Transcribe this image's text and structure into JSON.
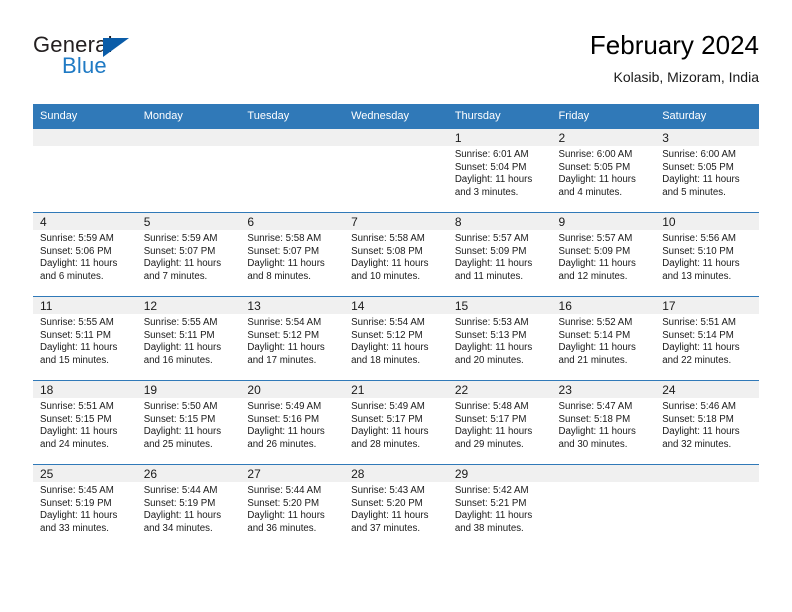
{
  "brand": {
    "name_part1": "General",
    "name_part2": "Blue",
    "logo_icon": "triangle-logo-icon",
    "accent_color": "#1f7ac4"
  },
  "header": {
    "title": "February 2024",
    "subtitle": "Kolasib, Mizoram, India"
  },
  "theme": {
    "header_bg": "#3079b8",
    "daynum_bg": "#f0f0f0",
    "text": "#1a1a1a"
  },
  "calendar": {
    "weekday_headers": [
      "Sunday",
      "Monday",
      "Tuesday",
      "Wednesday",
      "Thursday",
      "Friday",
      "Saturday"
    ],
    "weeks": [
      [
        {
          "day": "",
          "lines": []
        },
        {
          "day": "",
          "lines": []
        },
        {
          "day": "",
          "lines": []
        },
        {
          "day": "",
          "lines": []
        },
        {
          "day": "1",
          "lines": [
            "Sunrise: 6:01 AM",
            "Sunset: 5:04 PM",
            "Daylight: 11 hours",
            "and 3 minutes."
          ]
        },
        {
          "day": "2",
          "lines": [
            "Sunrise: 6:00 AM",
            "Sunset: 5:05 PM",
            "Daylight: 11 hours",
            "and 4 minutes."
          ]
        },
        {
          "day": "3",
          "lines": [
            "Sunrise: 6:00 AM",
            "Sunset: 5:05 PM",
            "Daylight: 11 hours",
            "and 5 minutes."
          ]
        }
      ],
      [
        {
          "day": "4",
          "lines": [
            "Sunrise: 5:59 AM",
            "Sunset: 5:06 PM",
            "Daylight: 11 hours",
            "and 6 minutes."
          ]
        },
        {
          "day": "5",
          "lines": [
            "Sunrise: 5:59 AM",
            "Sunset: 5:07 PM",
            "Daylight: 11 hours",
            "and 7 minutes."
          ]
        },
        {
          "day": "6",
          "lines": [
            "Sunrise: 5:58 AM",
            "Sunset: 5:07 PM",
            "Daylight: 11 hours",
            "and 8 minutes."
          ]
        },
        {
          "day": "7",
          "lines": [
            "Sunrise: 5:58 AM",
            "Sunset: 5:08 PM",
            "Daylight: 11 hours",
            "and 10 minutes."
          ]
        },
        {
          "day": "8",
          "lines": [
            "Sunrise: 5:57 AM",
            "Sunset: 5:09 PM",
            "Daylight: 11 hours",
            "and 11 minutes."
          ]
        },
        {
          "day": "9",
          "lines": [
            "Sunrise: 5:57 AM",
            "Sunset: 5:09 PM",
            "Daylight: 11 hours",
            "and 12 minutes."
          ]
        },
        {
          "day": "10",
          "lines": [
            "Sunrise: 5:56 AM",
            "Sunset: 5:10 PM",
            "Daylight: 11 hours",
            "and 13 minutes."
          ]
        }
      ],
      [
        {
          "day": "11",
          "lines": [
            "Sunrise: 5:55 AM",
            "Sunset: 5:11 PM",
            "Daylight: 11 hours",
            "and 15 minutes."
          ]
        },
        {
          "day": "12",
          "lines": [
            "Sunrise: 5:55 AM",
            "Sunset: 5:11 PM",
            "Daylight: 11 hours",
            "and 16 minutes."
          ]
        },
        {
          "day": "13",
          "lines": [
            "Sunrise: 5:54 AM",
            "Sunset: 5:12 PM",
            "Daylight: 11 hours",
            "and 17 minutes."
          ]
        },
        {
          "day": "14",
          "lines": [
            "Sunrise: 5:54 AM",
            "Sunset: 5:12 PM",
            "Daylight: 11 hours",
            "and 18 minutes."
          ]
        },
        {
          "day": "15",
          "lines": [
            "Sunrise: 5:53 AM",
            "Sunset: 5:13 PM",
            "Daylight: 11 hours",
            "and 20 minutes."
          ]
        },
        {
          "day": "16",
          "lines": [
            "Sunrise: 5:52 AM",
            "Sunset: 5:14 PM",
            "Daylight: 11 hours",
            "and 21 minutes."
          ]
        },
        {
          "day": "17",
          "lines": [
            "Sunrise: 5:51 AM",
            "Sunset: 5:14 PM",
            "Daylight: 11 hours",
            "and 22 minutes."
          ]
        }
      ],
      [
        {
          "day": "18",
          "lines": [
            "Sunrise: 5:51 AM",
            "Sunset: 5:15 PM",
            "Daylight: 11 hours",
            "and 24 minutes."
          ]
        },
        {
          "day": "19",
          "lines": [
            "Sunrise: 5:50 AM",
            "Sunset: 5:15 PM",
            "Daylight: 11 hours",
            "and 25 minutes."
          ]
        },
        {
          "day": "20",
          "lines": [
            "Sunrise: 5:49 AM",
            "Sunset: 5:16 PM",
            "Daylight: 11 hours",
            "and 26 minutes."
          ]
        },
        {
          "day": "21",
          "lines": [
            "Sunrise: 5:49 AM",
            "Sunset: 5:17 PM",
            "Daylight: 11 hours",
            "and 28 minutes."
          ]
        },
        {
          "day": "22",
          "lines": [
            "Sunrise: 5:48 AM",
            "Sunset: 5:17 PM",
            "Daylight: 11 hours",
            "and 29 minutes."
          ]
        },
        {
          "day": "23",
          "lines": [
            "Sunrise: 5:47 AM",
            "Sunset: 5:18 PM",
            "Daylight: 11 hours",
            "and 30 minutes."
          ]
        },
        {
          "day": "24",
          "lines": [
            "Sunrise: 5:46 AM",
            "Sunset: 5:18 PM",
            "Daylight: 11 hours",
            "and 32 minutes."
          ]
        }
      ],
      [
        {
          "day": "25",
          "lines": [
            "Sunrise: 5:45 AM",
            "Sunset: 5:19 PM",
            "Daylight: 11 hours",
            "and 33 minutes."
          ]
        },
        {
          "day": "26",
          "lines": [
            "Sunrise: 5:44 AM",
            "Sunset: 5:19 PM",
            "Daylight: 11 hours",
            "and 34 minutes."
          ]
        },
        {
          "day": "27",
          "lines": [
            "Sunrise: 5:44 AM",
            "Sunset: 5:20 PM",
            "Daylight: 11 hours",
            "and 36 minutes."
          ]
        },
        {
          "day": "28",
          "lines": [
            "Sunrise: 5:43 AM",
            "Sunset: 5:20 PM",
            "Daylight: 11 hours",
            "and 37 minutes."
          ]
        },
        {
          "day": "29",
          "lines": [
            "Sunrise: 5:42 AM",
            "Sunset: 5:21 PM",
            "Daylight: 11 hours",
            "and 38 minutes."
          ]
        },
        {
          "day": "",
          "lines": []
        },
        {
          "day": "",
          "lines": []
        }
      ]
    ]
  }
}
